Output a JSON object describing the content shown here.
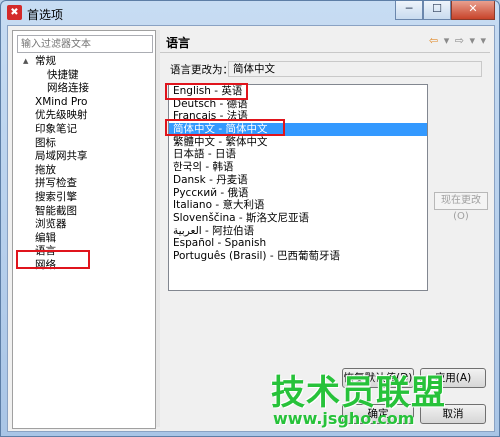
{
  "window": {
    "title": "首选项",
    "app_icon_glyph": "✖",
    "controls": {
      "minimize": "─",
      "maximize": "☐",
      "close": "✕"
    }
  },
  "sidebar": {
    "filter_placeholder": "输入过滤器文本",
    "items": [
      {
        "label": "常规",
        "indent": 1,
        "expander": "▲"
      },
      {
        "label": "快捷键",
        "indent": 2
      },
      {
        "label": "网络连接",
        "indent": 2
      },
      {
        "label": "XMind Pro",
        "indent": 1
      },
      {
        "label": "优先级映射",
        "indent": 1
      },
      {
        "label": "印象笔记",
        "indent": 1
      },
      {
        "label": "图标",
        "indent": 1
      },
      {
        "label": "局域网共享",
        "indent": 1
      },
      {
        "label": "拖放",
        "indent": 1
      },
      {
        "label": "拼写检查",
        "indent": 1
      },
      {
        "label": "搜索引擎",
        "indent": 1
      },
      {
        "label": "智能截图",
        "indent": 1
      },
      {
        "label": "浏览器",
        "indent": 1
      },
      {
        "label": "编辑",
        "indent": 1
      },
      {
        "label": "语言",
        "indent": 1,
        "selected": true
      },
      {
        "label": "网络",
        "indent": 1
      }
    ]
  },
  "page": {
    "title": "语言",
    "nav": {
      "back": "⇦",
      "back_menu": "▾",
      "forward": "⇨",
      "forward_menu": "▾",
      "menu": "▾"
    },
    "change_label": "语言更改为：",
    "current_language": "简体中文",
    "languages": [
      "English - 英语",
      "Deutsch - 德语",
      "Français - 法语",
      "简体中文 - 简体中文",
      "繁體中文 - 繁体中文",
      "日本語 - 日语",
      "한국의 - 韩语",
      "Dansk - 丹麦语",
      "Русский - 俄语",
      "Italiano - 意大利语",
      "Slovenščina - 斯洛文尼亚语",
      "العربية - 阿拉伯语",
      "Español - Spanish",
      "Português (Brasil) - 巴西葡萄牙语"
    ],
    "selected_index": 3,
    "apply_now_label": "现在更改(O)"
  },
  "buttons": {
    "restore_defaults": "恢复默认值(D)",
    "apply": "应用(A)",
    "ok": "确定",
    "cancel": "取消"
  },
  "watermark": {
    "title": "技术员联盟",
    "url": "www.jsgho.com"
  },
  "colors": {
    "highlight_box": "#e0141c",
    "selection": "#3399ff",
    "watermark": "#27c23a"
  }
}
